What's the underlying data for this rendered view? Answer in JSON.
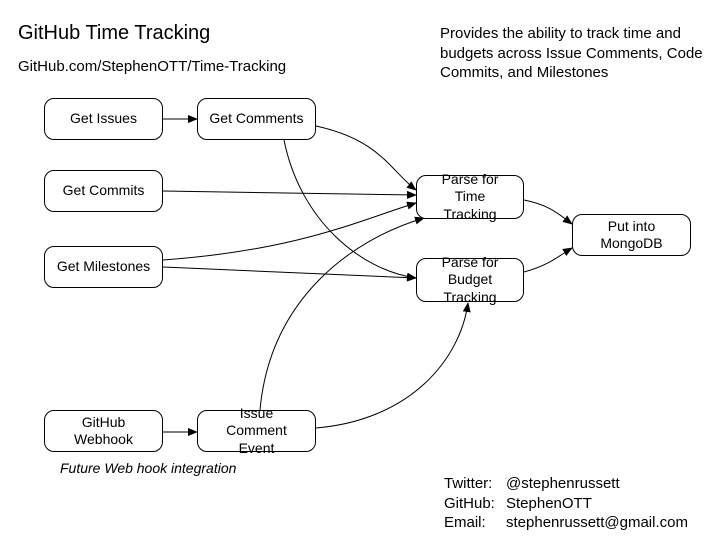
{
  "title": "GitHub Time Tracking",
  "subtitle": "GitHub.com/StephenOTT/Time-Tracking",
  "description": "Provides the ability to track time and budgets across Issue Comments, Code Commits, and Milestones",
  "nodes": {
    "get_issues": "Get Issues",
    "get_comments": "Get Comments",
    "get_commits": "Get Commits",
    "get_milestones": "Get Milestones",
    "github_webhook": "GitHub Webhook",
    "issue_comment_event": "Issue Comment Event",
    "parse_time": "Parse for Time Tracking",
    "parse_budget": "Parse for Budget Tracking",
    "mongodb": "Put into MongoDB"
  },
  "caption_webhook": "Future Web hook integration",
  "contact": {
    "twitter_label": "Twitter:",
    "twitter_value": "@stephenrussett",
    "github_label": "GitHub:",
    "github_value": "StephenOTT",
    "email_label": "Email:",
    "email_value": "stephenrussett@gmail.com"
  }
}
